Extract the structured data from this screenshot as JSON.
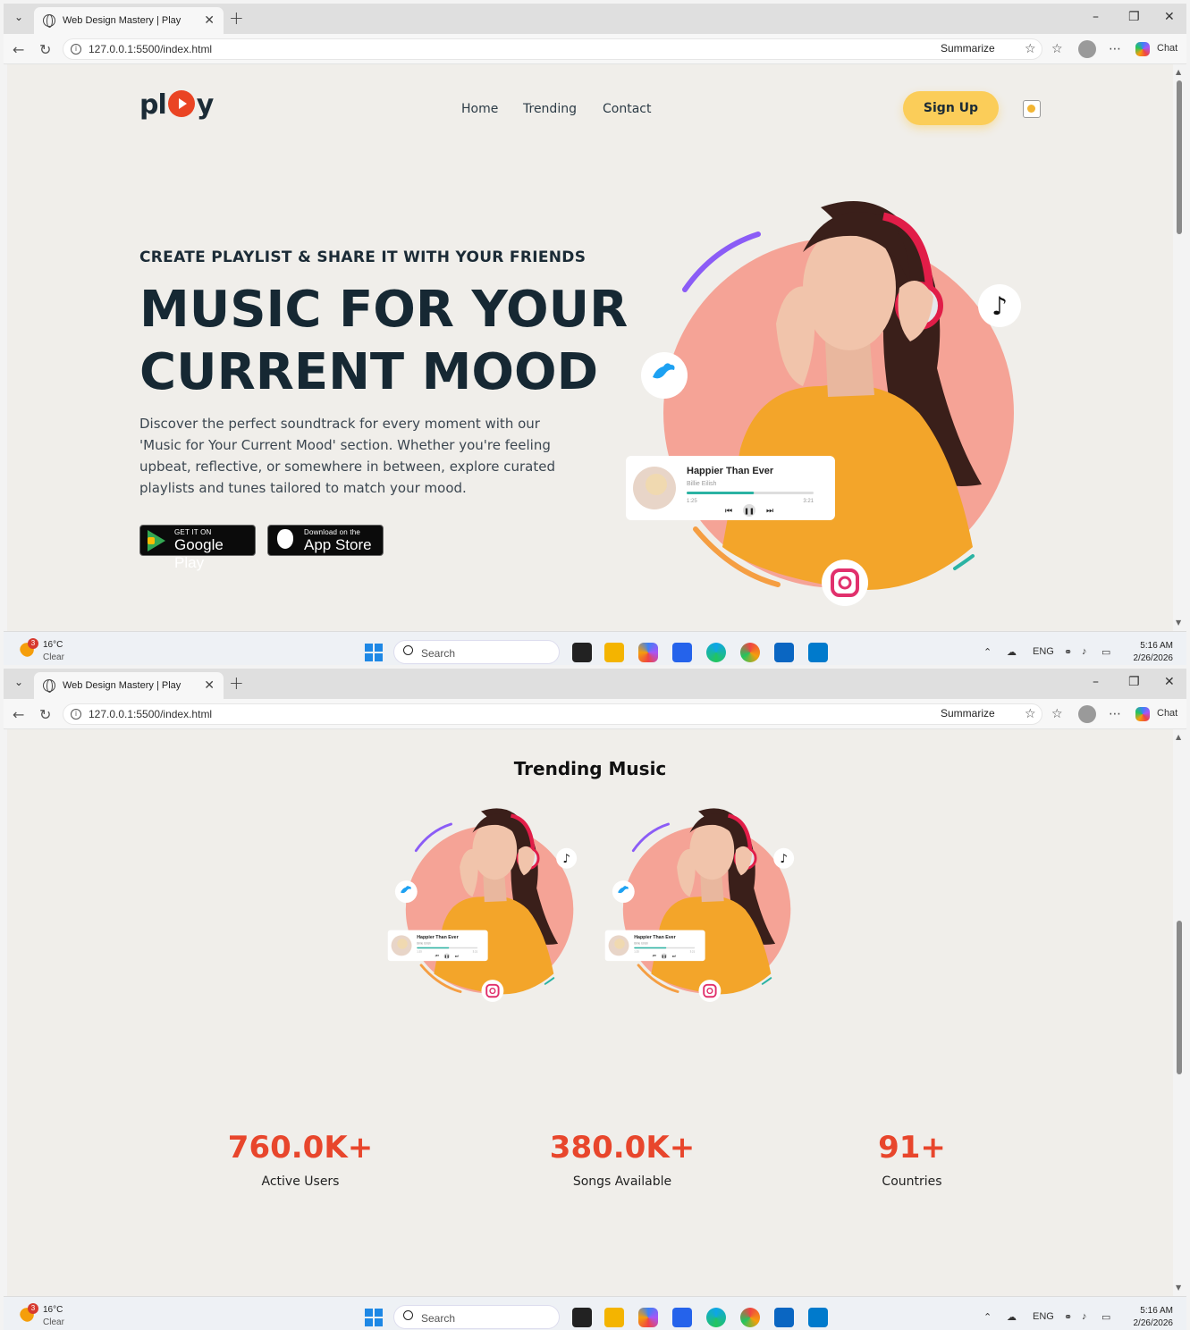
{
  "browser": {
    "tab_title": "Web Design Mastery | Play",
    "url": "127.0.0.1:5500/index.html",
    "summarize_label": "Summarize",
    "chat_label": "Chat"
  },
  "taskbar": {
    "temperature": "16°C",
    "condition": "Clear",
    "weather_badge": "3",
    "search_label": "Search",
    "language": "ENG",
    "time": "5:16 AM",
    "date": "2/26/2026"
  },
  "header": {
    "logo_left": "pl",
    "logo_right": "y",
    "nav": [
      "Home",
      "Trending",
      "Contact"
    ],
    "signup_label": "Sign Up"
  },
  "hero": {
    "eyebrow": "CREATE PLAYLIST & SHARE IT WITH YOUR FRIENDS",
    "headline_line1": "MUSIC FOR YOUR",
    "headline_line2": "CURRENT MOOD",
    "description": "Discover the perfect soundtrack for every moment with our 'Music for Your Current Mood' section. Whether you're feeling upbeat, reflective, or somewhere in between, explore curated playlists and tunes tailored to match your mood.",
    "google_play_small": "GET IT ON",
    "google_play_big": "Google Play",
    "app_store_small": "Download on the",
    "app_store_big": "App Store"
  },
  "player": {
    "song": "Happier Than Ever",
    "artist": "Billie Eilish",
    "elapsed": "1:25",
    "duration": "3:21",
    "progress": 0.53
  },
  "trending": {
    "title": "Trending Music"
  },
  "stats": [
    {
      "value": "760.0K+",
      "label": "Active Users"
    },
    {
      "value": "380.0K+",
      "label": "Songs Available"
    },
    {
      "value": "91+",
      "label": "Countries"
    }
  ],
  "colors": {
    "accent": "#e8462c",
    "signup": "#fbcd59",
    "blob": "#f5a396",
    "page_bg": "#f0eeea"
  }
}
